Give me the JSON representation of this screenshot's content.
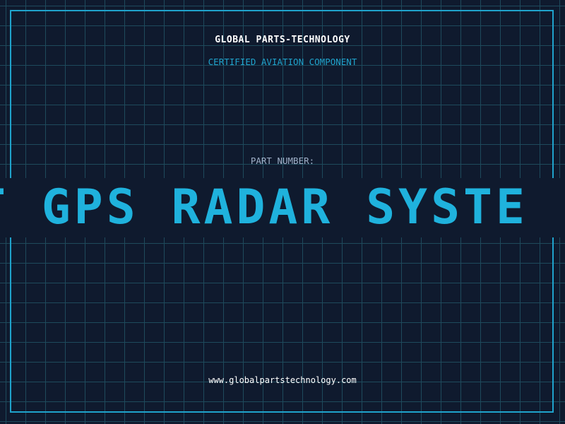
{
  "brand": {
    "name": "GLOBAL PARTS-TECHNOLOGY",
    "subtitle": "CERTIFIED AVIATION COMPONENT"
  },
  "part": {
    "label": "PART NUMBER:",
    "value": "AT GPS RADAR SYSTE"
  },
  "footer": {
    "website": "www.globalpartstechnology.com"
  },
  "colors": {
    "background": "#0f1a2e",
    "grid": "#1e4a5c",
    "accent": "#1fa3cc",
    "text": "#ffffff",
    "muted": "#9fb0c8"
  }
}
